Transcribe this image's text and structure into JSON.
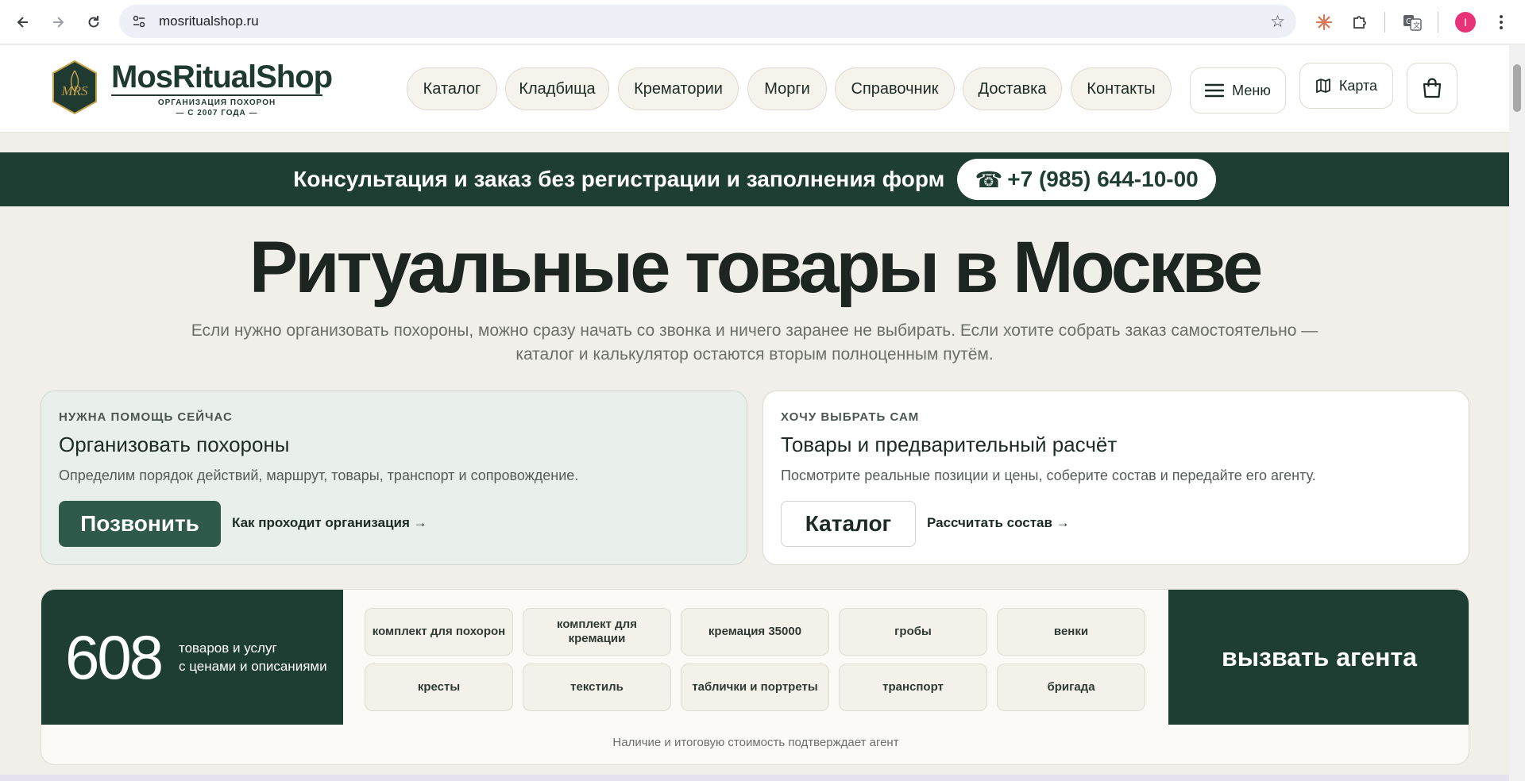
{
  "browser": {
    "url": "mosritualshop.ru",
    "icons": [
      "back-icon",
      "forward-icon",
      "reload-icon",
      "site-info-icon",
      "bookmark-star-icon",
      "claude-extension-icon",
      "extensions-puzzle-icon",
      "translate-icon",
      "menu-kebab-icon"
    ],
    "profile_initial": "I"
  },
  "header": {
    "logo_mark": "MRS",
    "logo_title": "MosRitualShop",
    "logo_sub_line1": "ОРГАНИЗАЦИЯ ПОХОРОН",
    "logo_sub_line2": "— С 2007 ГОДА —",
    "nav": [
      "Каталог",
      "Кладбища",
      "Крематории",
      "Морги",
      "Справочник",
      "Доставка",
      "Контакты"
    ],
    "menu_label": "Меню",
    "map_label": "Карта"
  },
  "banner": {
    "text": "Консультация и заказ без регистрации и заполнения форм",
    "phone": "+7 (985) 644-10-00"
  },
  "hero": {
    "title": "Ритуальные товары в Москве",
    "subtitle_line1": "Если нужно организовать похороны, можно сразу начать со звонка и ничего заранее не выбирать. Если хотите собрать заказ самостоятельно —",
    "subtitle_line2": "каталог и калькулятор остаются вторым полноценным путём."
  },
  "cards": {
    "left": {
      "kicker": "НУЖНА ПОМОЩЬ СЕЙЧАС",
      "title": "Организовать похороны",
      "desc": "Определим порядок действий, маршрут, товары, транспорт и сопровождение.",
      "button": "Позвонить",
      "link": "Как проходит организация →"
    },
    "right": {
      "kicker": "ХОЧУ ВЫБРАТЬ САМ",
      "title": "Товары и предварительный расчёт",
      "desc": "Посмотрите реальные позиции и цены, соберите состав и передайте его агенту.",
      "button": "Каталог",
      "link": "Рассчитать состав →"
    }
  },
  "stats": {
    "count": "608",
    "count_label_line1": "товаров и услуг",
    "count_label_line2": "с ценами и описаниями",
    "chips": [
      "комплект для похорон",
      "комплект для кремации",
      "кремация 35000",
      "гробы",
      "венки",
      "кресты",
      "текстиль",
      "таблички и портреты",
      "транспорт",
      "бригада"
    ],
    "cta": "вызвать агента",
    "note": "Наличие и итоговую стоимость подтверждает агент"
  },
  "colors": {
    "brand_dark_green": "#1e3d33",
    "button_green": "#2f5a4b",
    "page_bg": "#f1efe9",
    "logo_gold": "#c9a24a"
  }
}
